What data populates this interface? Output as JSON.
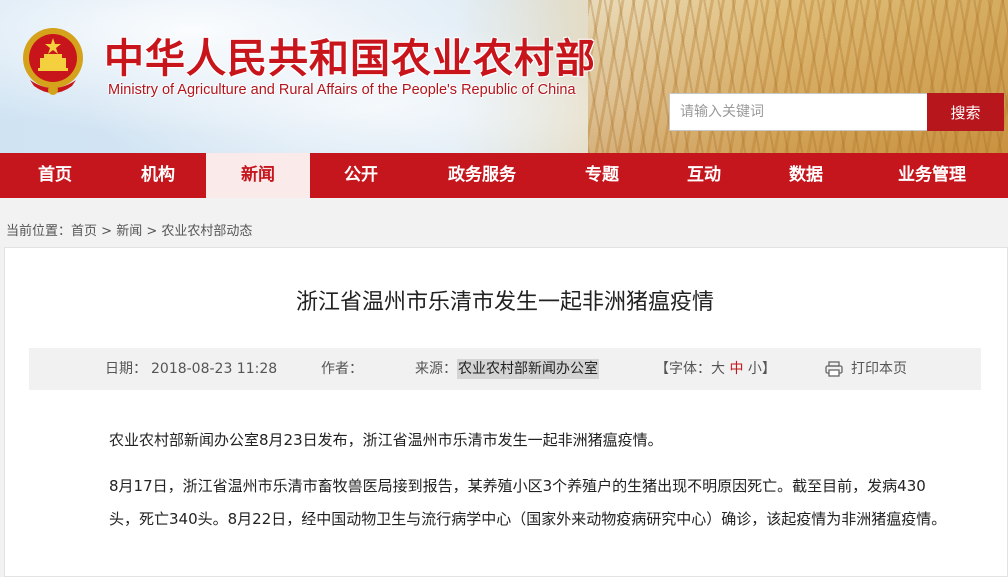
{
  "header": {
    "title_cn": "中华人民共和国农业农村部",
    "title_en": "Ministry of Agriculture and Rural Affairs of the People's Republic of China",
    "search_placeholder": "请输入关键词",
    "search_button": "搜索",
    "colors": {
      "brand_red": "#c4161c"
    }
  },
  "nav": {
    "items": [
      {
        "label": "首页"
      },
      {
        "label": "机构"
      },
      {
        "label": "新闻"
      },
      {
        "label": "公开"
      },
      {
        "label": "政务服务"
      },
      {
        "label": "专题"
      },
      {
        "label": "互动"
      },
      {
        "label": "数据"
      },
      {
        "label": "业务管理"
      }
    ],
    "active": "新闻"
  },
  "breadcrumb": {
    "prefix": "当前位置：",
    "items": [
      "首页",
      "新闻",
      "农业农村部动态"
    ],
    "separator": ">"
  },
  "article": {
    "title": "浙江省温州市乐清市发生一起非洲猪瘟疫情",
    "meta": {
      "date_label": "日期：",
      "date_value": "2018-08-23 11:28",
      "author_label": "作者：",
      "source_label": "来源：",
      "source_value": "农业农村部新闻办公室",
      "font_label_open": "【字体：",
      "font_large": "大",
      "font_medium": "中",
      "font_small": "小",
      "font_label_close": "】",
      "print_label": "打印本页",
      "print_icon": "printer-icon"
    },
    "paragraphs": [
      "农业农村部新闻办公室8月23日发布，浙江省温州市乐清市发生一起非洲猪瘟疫情。",
      "8月17日，浙江省温州市乐清市畜牧兽医局接到报告，某养殖小区3个养殖户的生猪出现不明原因死亡。截至目前，发病430头，死亡340头。8月22日，经中国动物卫生与流行病学中心（国家外来动物疫病研究中心）确诊，该起疫情为非洲猪瘟疫情。"
    ]
  }
}
